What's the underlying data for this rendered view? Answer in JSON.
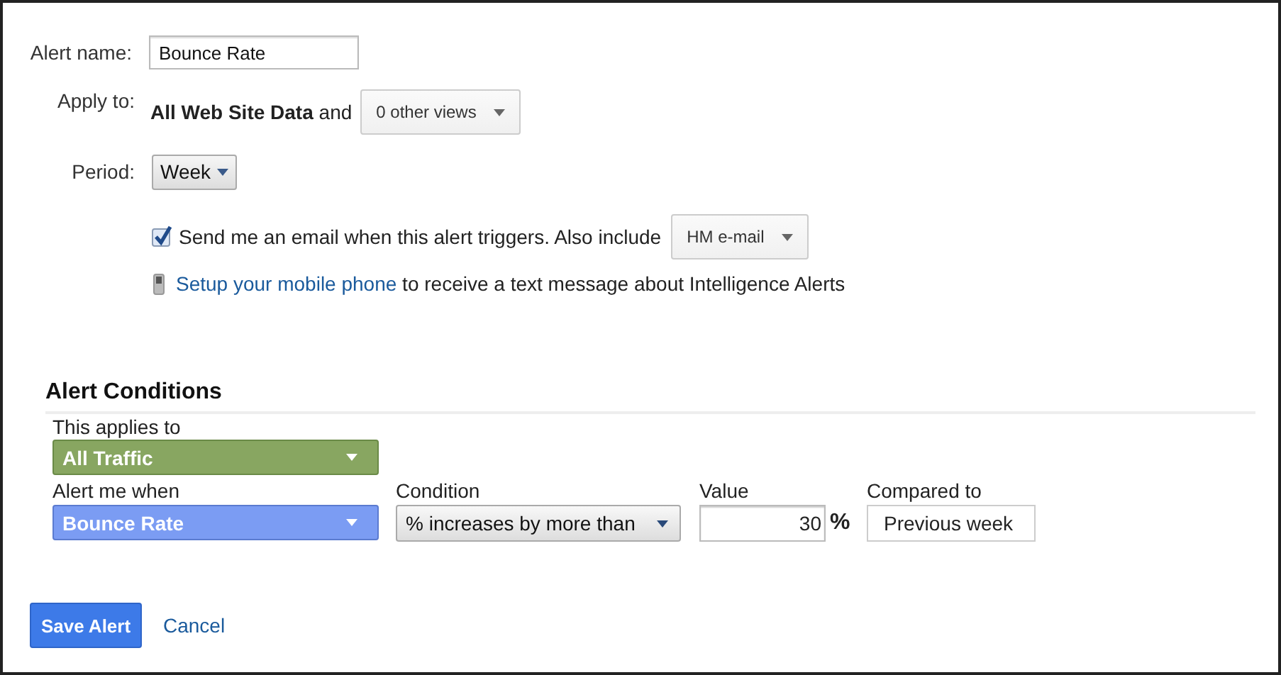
{
  "form": {
    "alert_name": {
      "label": "Alert name:",
      "value": "Bounce Rate"
    },
    "apply_to": {
      "label": "Apply to:",
      "text": "**All Web Site Data** and",
      "dropdown": "0 other views"
    },
    "period": {
      "label": "Period:",
      "dropdown": "Week"
    },
    "email": {
      "checked": true,
      "text": "Send me an email when this alert triggers. Also include",
      "dropdown": "HM e-mail"
    },
    "mobile": {
      "link": "Setup your mobile phone",
      "text": "to receive a text message about Intelligence Alerts"
    }
  },
  "conditions": {
    "title": "Alert Conditions",
    "applies_to": {
      "label": "This applies to",
      "value": "All Traffic"
    },
    "fields": [
      {
        "kind": "metric",
        "label": "Alert me when",
        "value": "Bounce Rate"
      },
      {
        "kind": "select",
        "label": "Condition",
        "value": "% increases by more than"
      },
      {
        "kind": "number",
        "label": "Value",
        "value": "30",
        "unit": "%"
      },
      {
        "kind": "box",
        "label": "Compared to",
        "value": "Previous week"
      }
    ]
  },
  "buttons": {
    "save": "Save Alert",
    "cancel": "Cancel"
  }
}
